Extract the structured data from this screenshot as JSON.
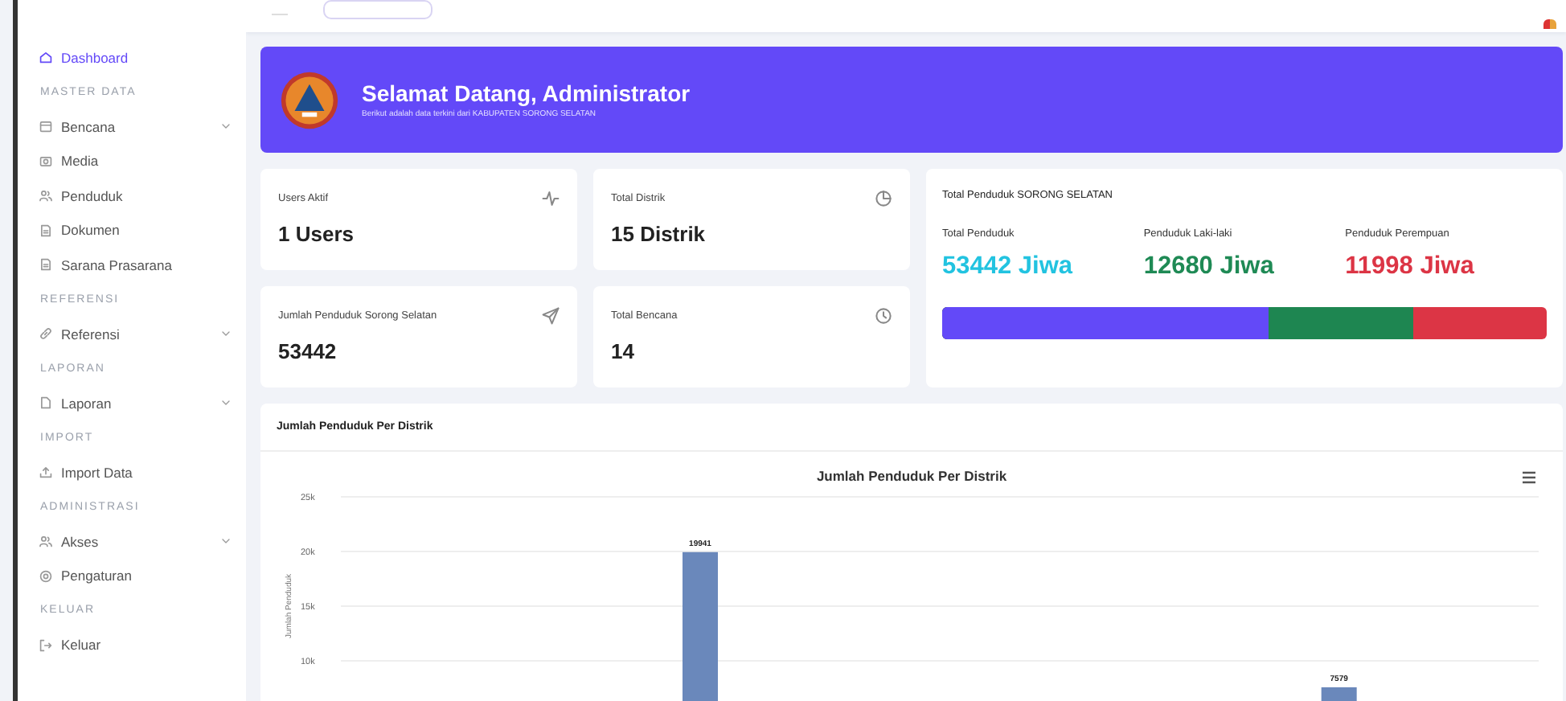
{
  "sidebar": {
    "items": [
      {
        "kind": "link",
        "label": "Dashboard",
        "selected": true
      },
      {
        "kind": "section",
        "label": "MASTER DATA"
      },
      {
        "kind": "link",
        "label": "Bencana",
        "selected": false,
        "expandable": true
      },
      {
        "kind": "link",
        "label": "Media",
        "selected": false
      },
      {
        "kind": "link",
        "label": "Penduduk",
        "selected": false
      },
      {
        "kind": "link",
        "label": "Dokumen",
        "selected": false
      },
      {
        "kind": "link",
        "label": "Sarana Prasarana",
        "selected": false
      },
      {
        "kind": "section",
        "label": "REFERENSI"
      },
      {
        "kind": "link",
        "label": "Referensi",
        "selected": false,
        "expandable": true
      },
      {
        "kind": "section",
        "label": "LAPORAN"
      },
      {
        "kind": "link",
        "label": "Laporan",
        "selected": false,
        "expandable": true
      },
      {
        "kind": "section",
        "label": "IMPORT"
      },
      {
        "kind": "link",
        "label": "Import Data",
        "selected": false
      },
      {
        "kind": "section",
        "label": "ADMINISTRASI"
      },
      {
        "kind": "link",
        "label": "Akses",
        "selected": false,
        "expandable": true
      },
      {
        "kind": "link",
        "label": "Pengaturan",
        "selected": false
      },
      {
        "kind": "section",
        "label": "KELUAR"
      },
      {
        "kind": "link",
        "label": "Keluar",
        "selected": false
      }
    ]
  },
  "banner": {
    "title": "Selamat Datang, Administrator",
    "subtitle": "Berikut adalah data terkini dari KABUPATEN SORONG SELATAN"
  },
  "stat_cards": [
    {
      "label": "Users Aktif",
      "value": "1 Users"
    },
    {
      "label": "Total Distrik",
      "value": "15 Distrik"
    },
    {
      "label": "Jumlah Penduduk Sorong Selatan",
      "value": "53442"
    },
    {
      "label": "Total Bencana",
      "value": "14"
    }
  ],
  "population": {
    "title": "Total Penduduk SORONG SELATAN",
    "stats": [
      {
        "label": "Total Penduduk",
        "value": "53442 Jiwa",
        "color": "#22c3e0"
      },
      {
        "label": "Penduduk Laki-laki",
        "value": "12680 Jiwa",
        "color": "#1f8a55"
      },
      {
        "label": "Penduduk Perempuan",
        "value": "11998 Jiwa",
        "color": "#dc3545"
      }
    ],
    "bar": {
      "color": "#dc3545",
      "segments": [
        {
          "level": 0.54,
          "color": "#6349f8"
        },
        {
          "level": 0.78,
          "color": "#1e8651"
        }
      ]
    }
  },
  "chart_card": {
    "title": "Jumlah Penduduk Per Distrik",
    "chart_data": {
      "type": "bar",
      "title": "Jumlah Penduduk Per Distrik",
      "ylabel": "Jumlah Penduduk",
      "ylim": [
        0,
        25000
      ],
      "grid": true,
      "yticks": [
        {
          "value": 10000,
          "label": "10k"
        },
        {
          "value": 15000,
          "label": "15k"
        },
        {
          "value": 20000,
          "label": "20k"
        },
        {
          "value": 25000,
          "label": "25k"
        }
      ],
      "data_labels": true,
      "series": [
        {
          "color": "#6a88bb",
          "values": [
            null,
            null,
            null,
            null,
            19941,
            null,
            null,
            null,
            null,
            null,
            null,
            null,
            7579,
            null,
            null
          ]
        }
      ]
    }
  }
}
